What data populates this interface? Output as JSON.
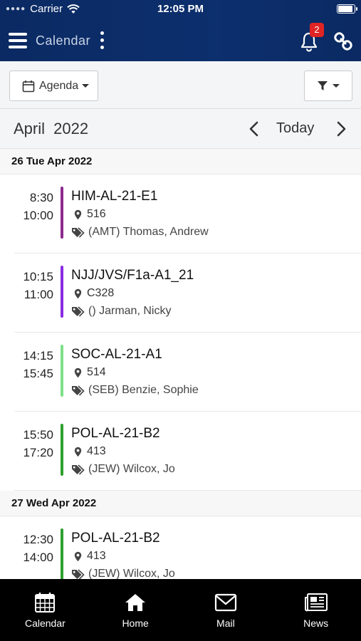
{
  "status_bar": {
    "carrier": "Carrier",
    "time": "12:05 PM"
  },
  "header": {
    "title": "Calendar",
    "notification_count": "2"
  },
  "toolbar": {
    "view_label": "Agenda"
  },
  "month_nav": {
    "month": "April 2022",
    "today_label": "Today"
  },
  "days": [
    {
      "label": "26 Tue Apr 2022",
      "events": [
        {
          "start": "8:30",
          "end": "10:00",
          "title": "HIM-AL-21-E1",
          "location": "516",
          "who": "(AMT) Thomas, Andrew",
          "color": "#8e2a8e"
        },
        {
          "start": "10:15",
          "end": "11:00",
          "title": "NJJ/JVS/F1a-A1_21",
          "location": "C328",
          "who": "() Jarman, Nicky",
          "color": "#8a2be2"
        },
        {
          "start": "14:15",
          "end": "15:45",
          "title": "SOC-AL-21-A1",
          "location": "514",
          "who": "(SEB) Benzie, Sophie",
          "color": "#7ee08a"
        },
        {
          "start": "15:50",
          "end": "17:20",
          "title": "POL-AL-21-B2",
          "location": "413",
          "who": "(JEW) Wilcox, Jo",
          "color": "#2ea02e"
        }
      ]
    },
    {
      "label": "27 Wed Apr 2022",
      "events": [
        {
          "start": "12:30",
          "end": "14:00",
          "title": "POL-AL-21-B2",
          "location": "413",
          "who": "(JEW) Wilcox, Jo",
          "color": "#2ea02e"
        }
      ]
    }
  ],
  "tabs": [
    {
      "label": "Calendar",
      "icon": "calendar-icon"
    },
    {
      "label": "Home",
      "icon": "home-icon"
    },
    {
      "label": "Mail",
      "icon": "mail-icon"
    },
    {
      "label": "News",
      "icon": "newspaper-icon"
    }
  ],
  "colors": {
    "header_bg": "#0b2a63",
    "badge": "#e02424",
    "tabbar_bg": "#000000"
  }
}
